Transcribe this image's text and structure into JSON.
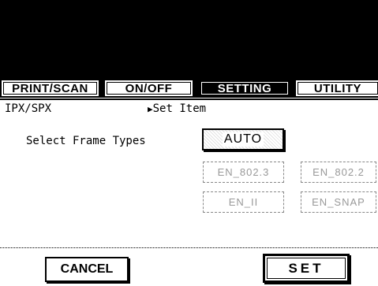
{
  "tabs": [
    {
      "label": "PRINT/SCAN",
      "selected": false
    },
    {
      "label": "ON/OFF",
      "selected": false
    },
    {
      "label": "SETTING",
      "selected": true
    },
    {
      "label": "UTILITY",
      "selected": false
    }
  ],
  "subheader": {
    "section": "IPX/SPX",
    "arrow": "▶",
    "title": "Set Item"
  },
  "frame_label": "Select Frame Types",
  "frame_options": {
    "auto": "AUTO",
    "option2": "EN_802.3",
    "option3": "EN_802.2",
    "option4": "EN_II",
    "option5": "EN_SNAP"
  },
  "footer": {
    "cancel": "CANCEL",
    "set": "SET"
  }
}
